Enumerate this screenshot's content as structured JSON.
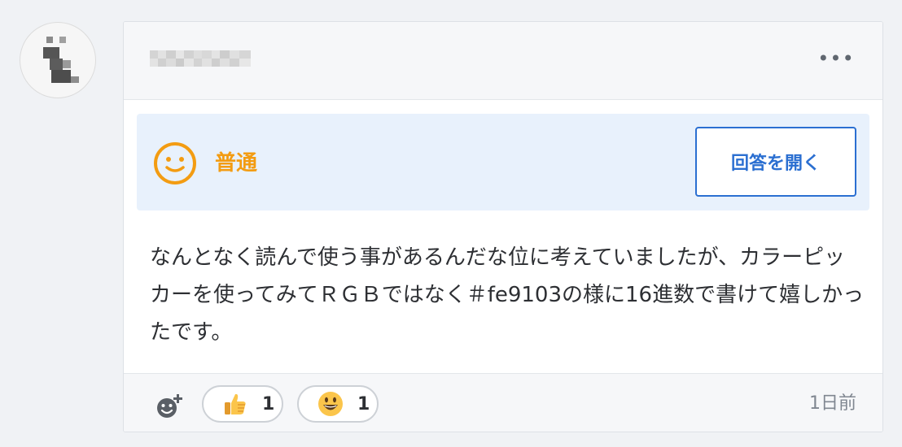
{
  "comment": {
    "difficulty_label": "普通",
    "open_answer_label": "回答を開く",
    "body": "なんとなく読んで使う事があるんだな位に考えていましたが、カラーピッカーを使ってみてＲＧＢではなく＃fe9103の様に16進数で書けて嬉しかったです。",
    "reactions": [
      {
        "icon": "thumbs-up-icon",
        "count": "1"
      },
      {
        "icon": "grinning-face-icon",
        "count": "1"
      }
    ],
    "timestamp": "1日前"
  },
  "colors": {
    "accent": "#2b6fd1",
    "difficulty": "#f39c12",
    "difficulty_bg": "#e8f1fc"
  }
}
